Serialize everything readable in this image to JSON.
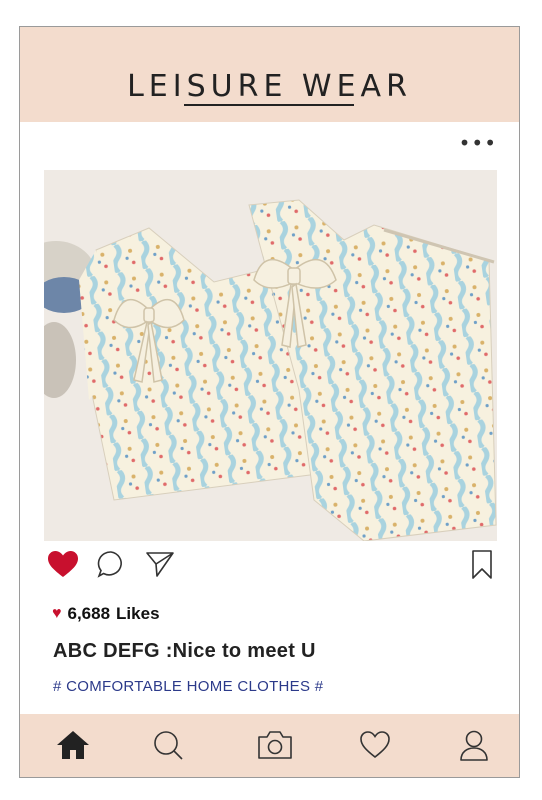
{
  "header": {
    "title": "LEISURE WEAR"
  },
  "post": {
    "more_label": "•••",
    "image_icon": "pajama-set-photo",
    "actions": [
      "heart-icon-filled",
      "comment-icon",
      "share-icon",
      "bookmark-icon"
    ],
    "likes_count": "6,688",
    "likes_label": "Likes",
    "caption": "ABC DEFG :Nice to meet U",
    "hashtag": "# COMFORTABLE HOME CLOTHES #"
  },
  "nav": {
    "items": [
      "home-icon",
      "search-icon",
      "camera-icon",
      "heart-icon",
      "profile-icon"
    ]
  },
  "colors": {
    "header_bg": "#f3dccd",
    "like_red": "#c8102e",
    "hashtag_blue": "#2c3a8a"
  }
}
